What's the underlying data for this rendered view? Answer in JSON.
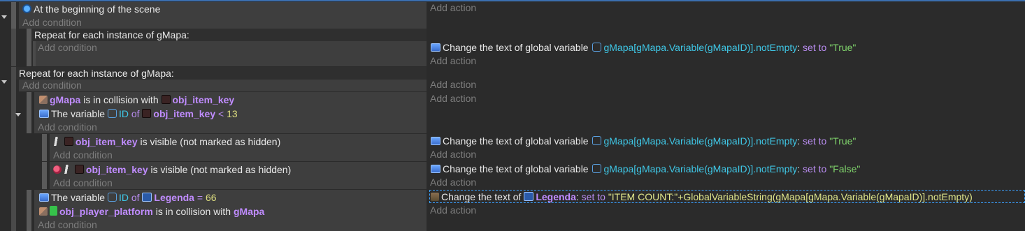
{
  "placeholders": {
    "add_condition": "Add condition",
    "add_action": "Add action"
  },
  "event1": {
    "condition": "At the beginning of the scene"
  },
  "event2": {
    "header": "Repeat for each instance of gMapa:",
    "action": {
      "prefix": "Change the text of global variable",
      "var": "gMapa[gMapa.Variable(gMapaID)].notEmpty",
      "sep": ":",
      "setto": "set to",
      "value": "\"True\""
    }
  },
  "event3": {
    "header": "Repeat for each instance of gMapa:",
    "cond1": {
      "obj": "gMapa",
      "text": "is in collision with",
      "target": "obj_item_key"
    },
    "cond2": {
      "prefix": "The variable",
      "var": "ID",
      "of": "of",
      "obj": "obj_item_key",
      "op": "<",
      "value": "13"
    }
  },
  "sub1": {
    "cond": {
      "obj": "obj_item_key",
      "text": "is visible (not marked as hidden)"
    },
    "action": {
      "prefix": "Change the text of global variable",
      "var": "gMapa[gMapa.Variable(gMapaID)].notEmpty",
      "sep": ":",
      "setto": "set to",
      "value": "\"True\""
    }
  },
  "sub2": {
    "cond": {
      "obj": "obj_item_key",
      "text": "is visible (not marked as hidden)"
    },
    "action": {
      "prefix": "Change the text of global variable",
      "var": "gMapa[gMapa.Variable(gMapaID)].notEmpty",
      "sep": ":",
      "setto": "set to",
      "value": "\"False\""
    }
  },
  "sub3": {
    "cond1": {
      "prefix": "The variable",
      "var": "ID",
      "of": "of",
      "obj": "Legenda",
      "op": "=",
      "value": "66"
    },
    "cond2": {
      "obj": "obj_player_platform",
      "text": "is in collision with",
      "target": "gMapa"
    },
    "action": {
      "prefix": "Change the text of",
      "obj": "Legenda",
      "sep": ":",
      "setto": "set to",
      "value": "\"ITEM COUNT:\"+GlobalVariableString(gMapa[gMapa.Variable(gMapaID)].notEmpty)"
    }
  }
}
